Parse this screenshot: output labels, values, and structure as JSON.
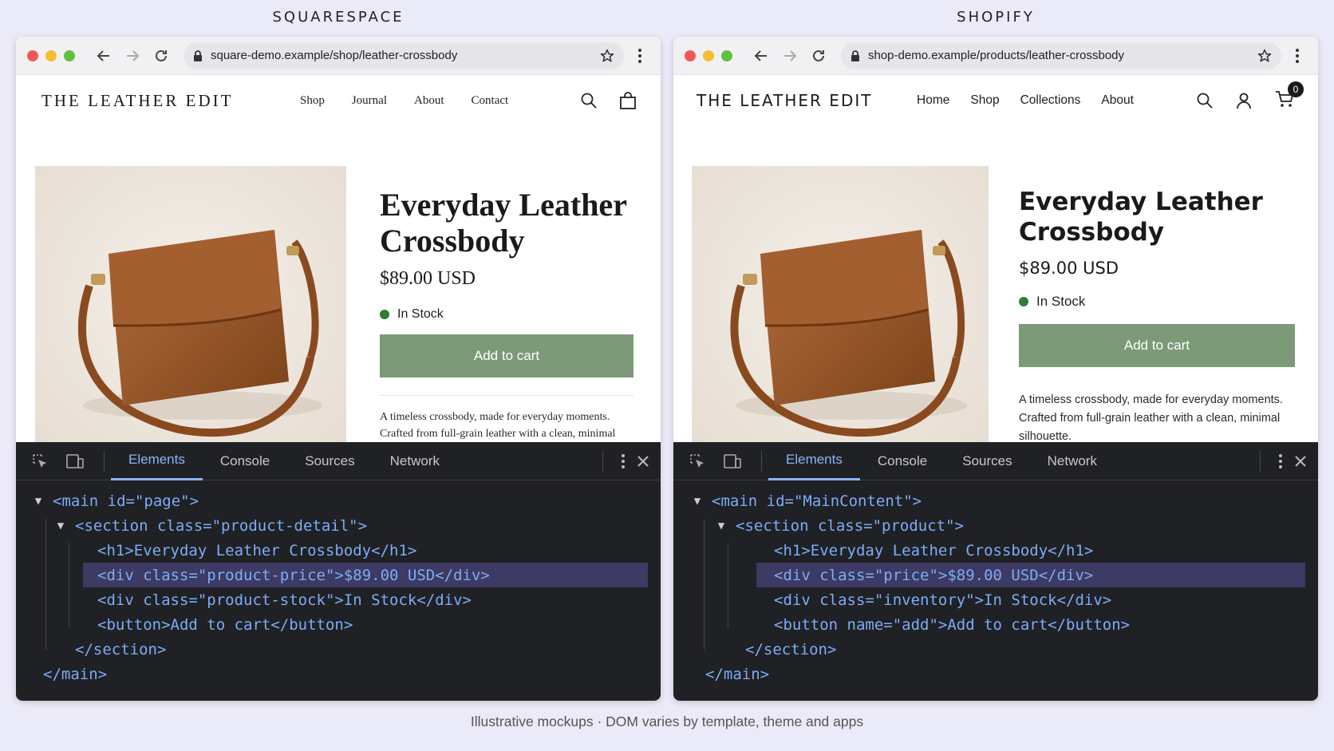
{
  "footer_note": "Illustrative mockups · DOM varies by template, theme and apps",
  "colors": {
    "button_bg": "#7d9a78",
    "stock_dot": "#2e7d32",
    "tab_active": "#8ab4f8",
    "selection_bg": "#3d3a63"
  },
  "squarespace": {
    "label": "SQUARESPACE",
    "url": "square-demo.example/shop/leather-crossbody",
    "brand": "THE LEATHER EDIT",
    "nav": [
      "Shop",
      "Journal",
      "About",
      "Contact"
    ],
    "product": {
      "title": "Everyday Leather Crossbody",
      "price": "$89.00 USD",
      "stock": "In Stock",
      "button": "Add to cart",
      "description": "A timeless crossbody, made for everyday moments. Crafted from full-grain leather with a clean, minimal silhouette."
    },
    "devtools": {
      "tabs": [
        "Elements",
        "Console",
        "Sources",
        "Network"
      ],
      "active_tab": "Elements",
      "dom": {
        "main_open": "<main id=\"page\">",
        "section_open": "<section class=\"product-detail\">",
        "h1": "<h1>Everyday Leather Crossbody</h1>",
        "price_div": "<div class=\"product-price\">$89.00 USD</div>",
        "stock_div": "<div class=\"product-stock\">In Stock</div>",
        "button": "<button>Add to cart</button>",
        "section_close": "</section>",
        "main_close": "</main>"
      }
    }
  },
  "shopify": {
    "label": "SHOPIFY",
    "url": "shop-demo.example/products/leather-crossbody",
    "brand": "THE LEATHER EDIT",
    "nav": [
      "Home",
      "Shop",
      "Collections",
      "About"
    ],
    "cart_count": "0",
    "product": {
      "title": "Everyday Leather Crossbody",
      "price": "$89.00 USD",
      "stock": "In Stock",
      "button": "Add to cart",
      "description": "A timeless crossbody, made for everyday moments. Crafted from full-grain leather with a clean, minimal silhouette."
    },
    "devtools": {
      "tabs": [
        "Elements",
        "Console",
        "Sources",
        "Network"
      ],
      "active_tab": "Elements",
      "dom": {
        "main_open": "<main id=\"MainContent\">",
        "section_open": "<section class=\"product\">",
        "h1": "<h1>Everyday Leather Crossbody</h1>",
        "price_div": "<div class=\"price\">$89.00 USD</div>",
        "stock_div": "<div class=\"inventory\">In Stock</div>",
        "button": "<button name=\"add\">Add to cart</button>",
        "section_close": "</section>",
        "main_close": "</main>"
      }
    }
  }
}
